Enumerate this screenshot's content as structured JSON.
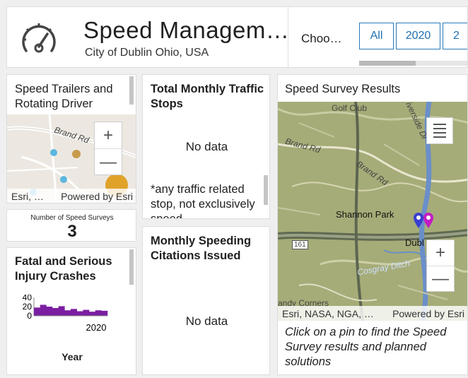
{
  "header": {
    "title": "Speed Managem…",
    "subtitle": "City of Dublin Ohio, USA",
    "choose_label": "Choo…",
    "filter_buttons": [
      "All",
      "2020",
      "2"
    ]
  },
  "trailers": {
    "title": "Speed Trailers and Rotating Driver",
    "attribution_left": "Esri, …",
    "attribution_right": "Powered by Esri",
    "map_label": "Brand Rd",
    "zoom_in": "+",
    "zoom_out": "—"
  },
  "surveys": {
    "label": "Number of Speed Surveys",
    "value": "3"
  },
  "crashes": {
    "title": "Fatal and Serious Injury Crashes",
    "xlabel": "Year",
    "chart_data": {
      "type": "bar",
      "ylim": [
        0,
        40
      ],
      "y_ticks": [
        "40",
        "20",
        "0"
      ],
      "x_ticks": [
        "2020"
      ],
      "values": [
        18,
        24,
        20,
        17,
        21,
        12,
        15,
        10,
        13,
        9,
        12,
        11
      ],
      "color": "#7b1fa2"
    }
  },
  "traffic_stops": {
    "title": "Total Monthly Traffic Stops",
    "no_data": "No data",
    "footnote": "*any traffic related stop, not exclusively speed"
  },
  "citations": {
    "title": "Monthly Speeding Citations Issued",
    "no_data": "No data"
  },
  "survey_results": {
    "title": "Speed Survey Results",
    "attribution_left": "Esri, NASA, NGA, …",
    "attribution_right": "Powered by Esri",
    "labels": {
      "golf": "Golf Club",
      "riverside": "iverside Dr",
      "brand1": "Brand Rd",
      "brand2": "Brand Rd",
      "shannon": "Shannon Park",
      "dublin": "Dubl",
      "cosgray": "Cosgray Ditch",
      "route": "161",
      "sandy": "andy Corners"
    },
    "zoom_in": "+",
    "zoom_out": "—",
    "note": "Click on a pin to find the Speed Survey results and planned solutions",
    "colors": {
      "pin_blue": "#3b3fd0",
      "pin_magenta": "#c21cc2"
    }
  }
}
